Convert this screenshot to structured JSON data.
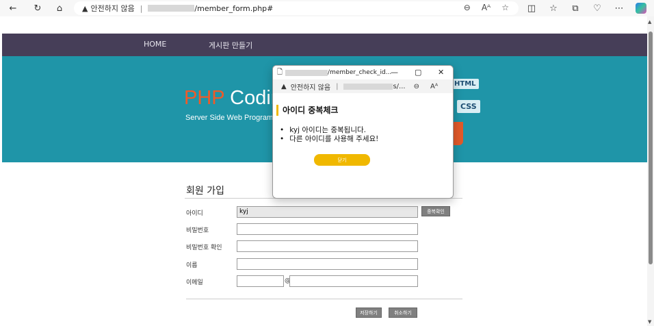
{
  "browser": {
    "security_text": "안전하지 않음",
    "url_path": "/member_form.php#"
  },
  "nav": {
    "home": "HOME",
    "board": "게시판 만들기"
  },
  "hero": {
    "php": "PHP",
    "coding": "Codin",
    "subtitle": "Server Side Web Program",
    "badge_html": "HTML",
    "badge_css": "CSS"
  },
  "form": {
    "title": "회원 가입",
    "labels": {
      "id": "아이디",
      "password": "비밀번호",
      "password_confirm": "비밀번호 확인",
      "name": "이름",
      "email": "이메일"
    },
    "values": {
      "id": "kyj"
    },
    "at_sign": "@",
    "check_button": "중복확인",
    "save_button": "저장하기",
    "cancel_button": "취소하기"
  },
  "popup": {
    "title_path": "/member_check_id...",
    "security_text": "안전하지 않음",
    "url_tail": "s/...",
    "heading": "아이디 중복체크",
    "messages": [
      "kyj 아이디는 중복됩니다.",
      "다른 아이디를 사용해 주세요!"
    ],
    "close_button": "닫기"
  },
  "colors": {
    "nav_bg": "#463e58",
    "hero_bg": "#1f95a8",
    "php_orange": "#f05a28",
    "accent_yellow": "#f0b800"
  }
}
